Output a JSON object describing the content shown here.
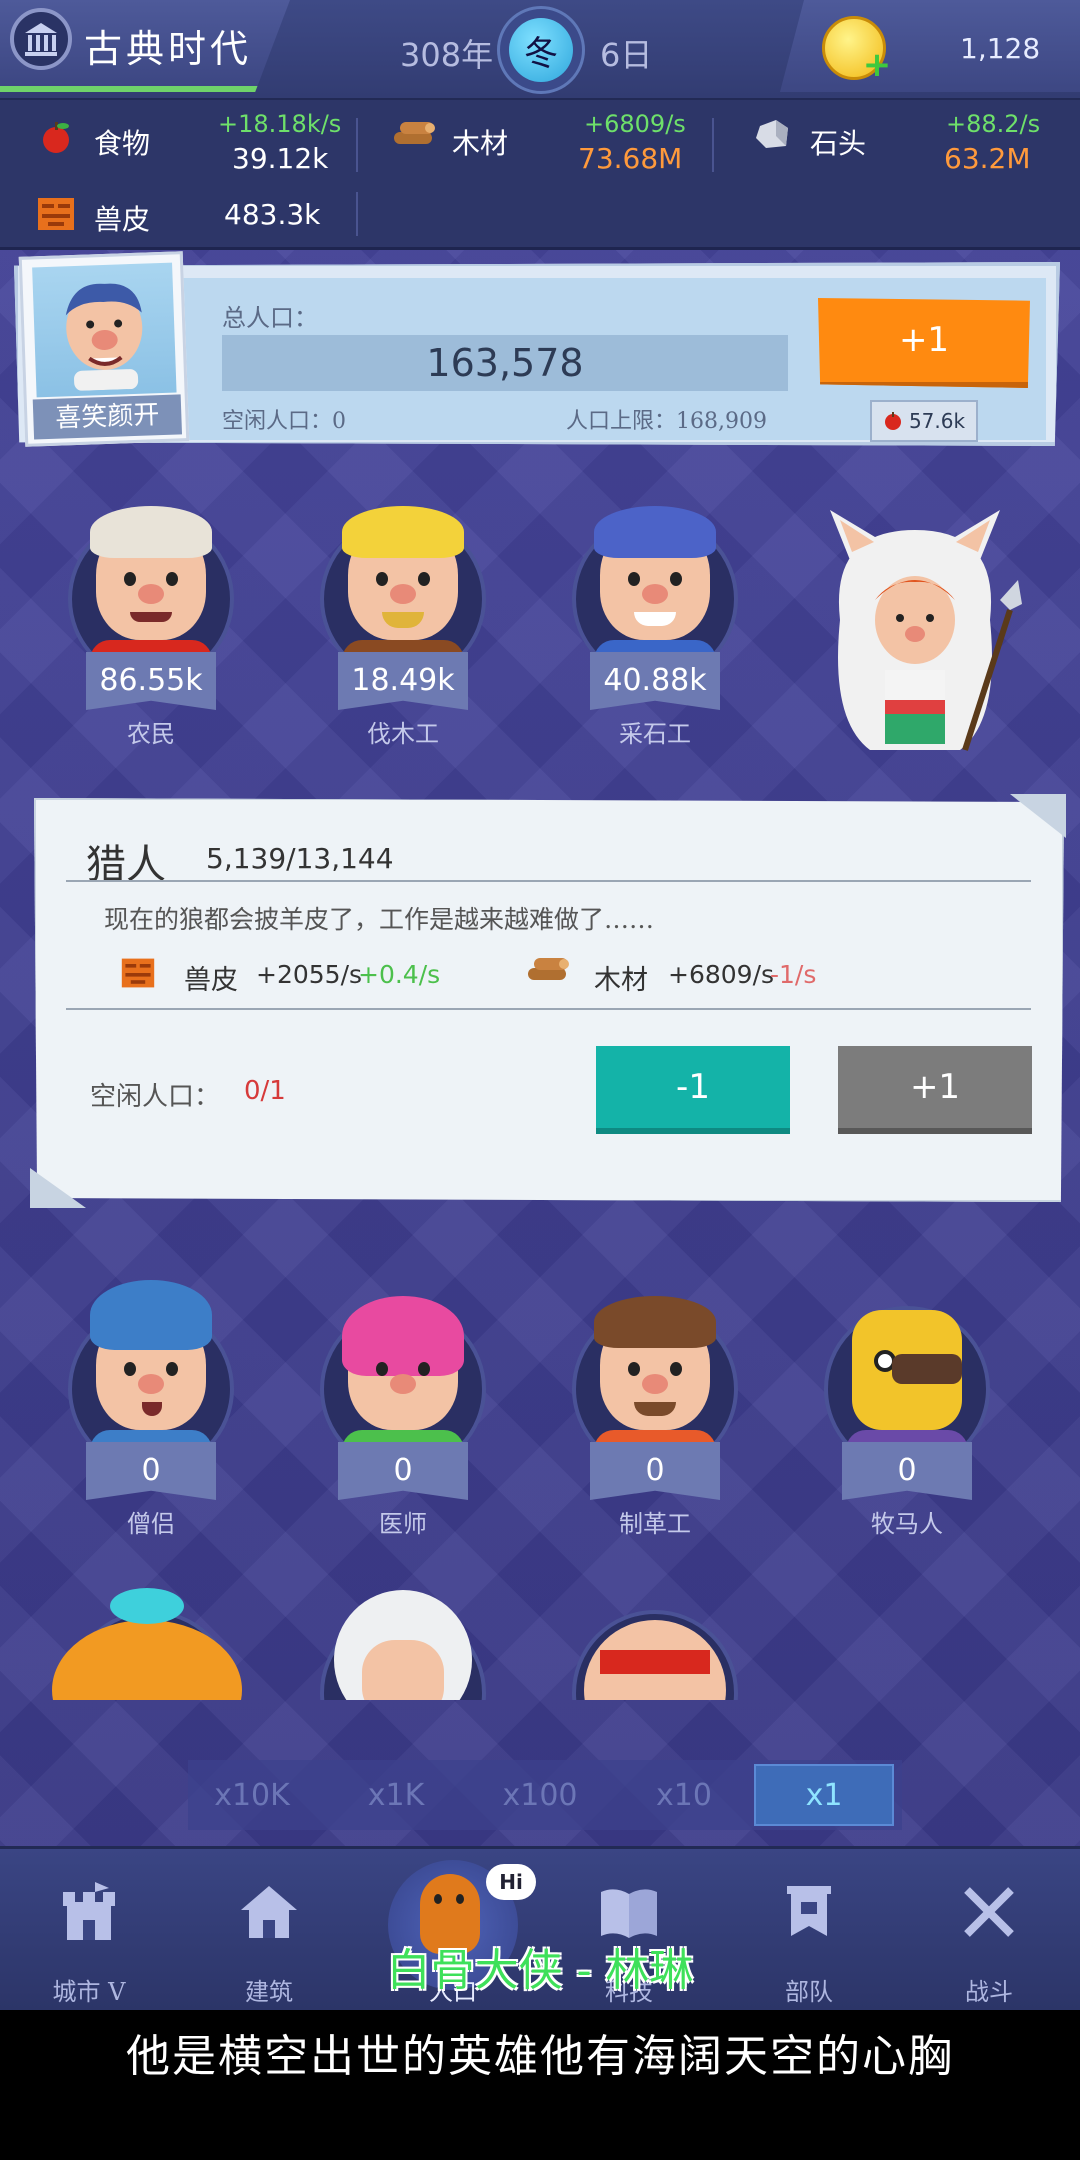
{
  "header": {
    "era_title": "古典时代",
    "year": "308年",
    "season": "冬",
    "day": "6日",
    "gold": "1,128"
  },
  "resources": [
    {
      "name": "食物",
      "rate": "+18.18k/s",
      "value": "39.12k",
      "value_color": "white"
    },
    {
      "name": "木材",
      "rate": "+6809/s",
      "value": "73.68M",
      "value_color": "orange"
    },
    {
      "name": "石头",
      "rate": "+88.2/s",
      "value": "63.2M",
      "value_color": "orange"
    },
    {
      "name": "兽皮",
      "rate": "",
      "value": "483.3k",
      "value_color": "white"
    }
  ],
  "population": {
    "leader_label": "喜笑颜开",
    "total_label": "总人口：",
    "total_value": "163,578",
    "idle_label": "空闲人口：0",
    "cap_label": "人口上限：168,909",
    "add_button": "+1",
    "food_cost": "57.6k"
  },
  "workers_top": [
    {
      "count": "86.55k",
      "name": "农民"
    },
    {
      "count": "18.49k",
      "name": "伐木工"
    },
    {
      "count": "40.88k",
      "name": "采石工"
    },
    {
      "count": "",
      "name": ""
    }
  ],
  "hunter": {
    "title": "猎人",
    "count": "5,139/13,144",
    "description": "现在的狼都会披羊皮了，工作是越来越难做了……",
    "produce": {
      "name": "兽皮",
      "rate": "+2055/s",
      "delta": "+0.4/s"
    },
    "consume": {
      "name": "木材",
      "rate": "+6809/s",
      "delta": "-1/s"
    },
    "idle_label": "空闲人口：",
    "idle_value": "0/1",
    "minus_button": "-1",
    "plus_button": "+1"
  },
  "workers_bottom": [
    {
      "count": "0",
      "name": "僧侣"
    },
    {
      "count": "0",
      "name": "医师"
    },
    {
      "count": "0",
      "name": "制革工"
    },
    {
      "count": "0",
      "name": "牧马人"
    }
  ],
  "multipliers": [
    "x10K",
    "x1K",
    "x100",
    "x10",
    "x1"
  ],
  "active_multiplier": "x1",
  "nav": [
    {
      "label": "城市 V",
      "icon": "castle-icon"
    },
    {
      "label": "建筑",
      "icon": "house-icon"
    },
    {
      "label": "人口",
      "icon": "mascot-icon"
    },
    {
      "label": "科技",
      "icon": "book-icon"
    },
    {
      "label": "部队",
      "icon": "banner-icon"
    },
    {
      "label": "战斗",
      "icon": "swords-icon"
    }
  ],
  "mascot_bubble": "Hi",
  "subtitle_green": "白骨大侠 - 林琳",
  "subtitle_white": "他是横空出世的英雄他有海阔天空的心胸",
  "colors": {
    "accent_orange": "#ff8a10",
    "teal_button": "#14b3a8",
    "rate_green": "#6ee06a",
    "value_orange": "#ff9a3c"
  }
}
